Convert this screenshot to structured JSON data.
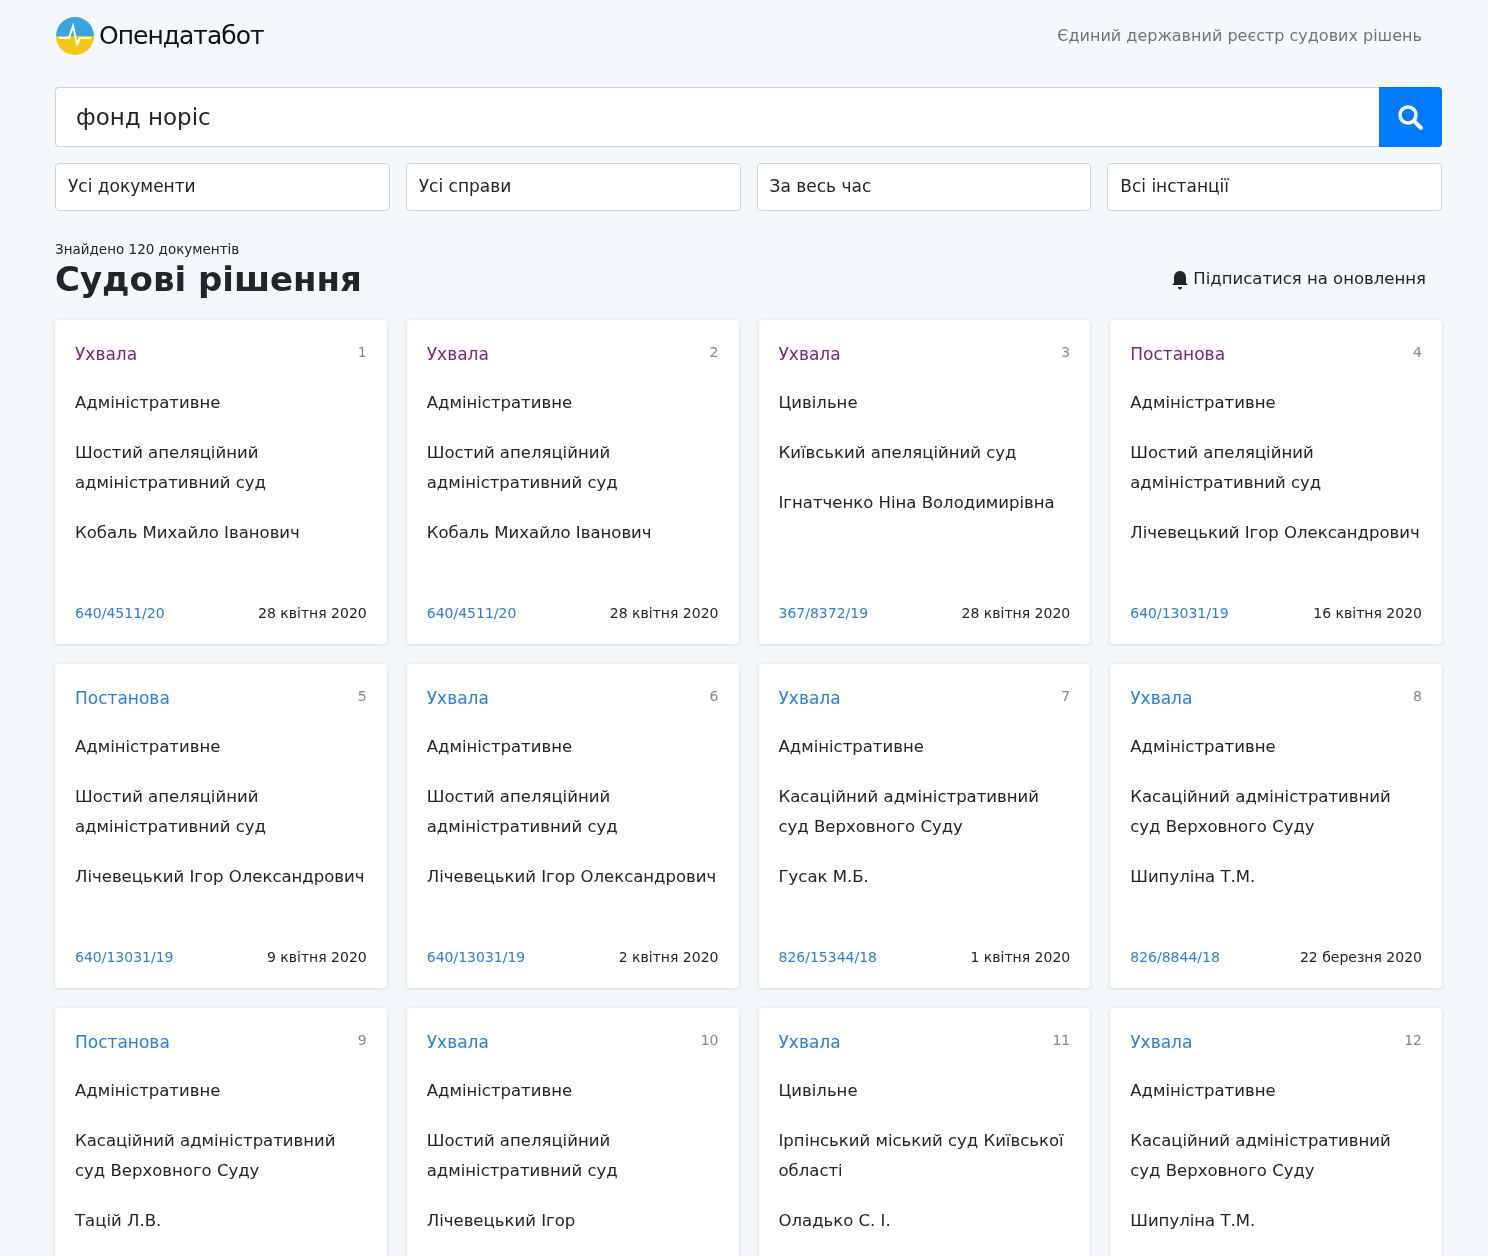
{
  "header": {
    "logo_text": "Опендатабот",
    "tagline": "Єдиний державний реєстр судових рішень"
  },
  "search": {
    "value": "фонд норіс"
  },
  "filters": [
    {
      "value": "Усі документи"
    },
    {
      "value": "Усі справи"
    },
    {
      "value": "За весь час"
    },
    {
      "value": "Всі інстанції"
    }
  ],
  "results": {
    "count_text": "Знайдено 120 документів",
    "title": "Судові рішення",
    "subscribe": "Підписатися на оновлення"
  },
  "cards": [
    {
      "doc_type": "Ухвала",
      "visited": true,
      "number": "1",
      "category": "Адміністративне",
      "court": "Шостий апеляційний адміністративний суд",
      "judge": "Кобаль Михайло Іванович",
      "case_number": "640/4511/20",
      "date": "28 квітня 2020"
    },
    {
      "doc_type": "Ухвала",
      "visited": true,
      "number": "2",
      "category": "Адміністративне",
      "court": "Шостий апеляційний адміністративний суд",
      "judge": "Кобаль Михайло Іванович",
      "case_number": "640/4511/20",
      "date": "28 квітня 2020"
    },
    {
      "doc_type": "Ухвала",
      "visited": true,
      "number": "3",
      "category": "Цивільне",
      "court": "Київський апеляційний суд",
      "judge": "Ігнатченко Ніна Володимирівна",
      "case_number": "367/8372/19",
      "date": "28 квітня 2020"
    },
    {
      "doc_type": "Постанова",
      "visited": true,
      "number": "4",
      "category": "Адміністративне",
      "court": "Шостий апеляційний адміністративний суд",
      "judge": "Лічевецький Ігор Олександрович",
      "case_number": "640/13031/19",
      "date": "16 квітня 2020"
    },
    {
      "doc_type": "Постанова",
      "visited": false,
      "number": "5",
      "category": "Адміністративне",
      "court": "Шостий апеляційний адміністративний суд",
      "judge": "Лічевецький Ігор Олександрович",
      "case_number": "640/13031/19",
      "date": "9 квітня 2020"
    },
    {
      "doc_type": "Ухвала",
      "visited": false,
      "number": "6",
      "category": "Адміністративне",
      "court": "Шостий апеляційний адміністративний суд",
      "judge": "Лічевецький Ігор Олександрович",
      "case_number": "640/13031/19",
      "date": "2 квітня 2020"
    },
    {
      "doc_type": "Ухвала",
      "visited": false,
      "number": "7",
      "category": "Адміністративне",
      "court": "Касаційний адміністративний суд Верховного Суду",
      "judge": "Гусак М.Б.",
      "case_number": "826/15344/18",
      "date": "1 квітня 2020"
    },
    {
      "doc_type": "Ухвала",
      "visited": false,
      "number": "8",
      "category": "Адміністративне",
      "court": "Касаційний адміністративний суд Верховного Суду",
      "judge": "Шипуліна Т.М.",
      "case_number": "826/8844/18",
      "date": "22 березня 2020"
    },
    {
      "doc_type": "Постанова",
      "visited": false,
      "number": "9",
      "category": "Адміністративне",
      "court": "Касаційний адміністративний суд Верховного Суду",
      "judge": "Тацій Л.В."
    },
    {
      "doc_type": "Ухвала",
      "visited": false,
      "number": "10",
      "category": "Адміністративне",
      "court": "Шостий апеляційний адміністративний суд",
      "judge": "Лічевецький Ігор"
    },
    {
      "doc_type": "Ухвала",
      "visited": false,
      "number": "11",
      "category": "Цивільне",
      "court": "Ірпінський міський суд Київської області",
      "judge": "Оладько С. І."
    },
    {
      "doc_type": "Ухвала",
      "visited": false,
      "number": "12",
      "category": "Адміністративне",
      "court": "Касаційний адміністративний суд Верховного Суду",
      "judge": "Шипуліна Т.М."
    }
  ]
}
